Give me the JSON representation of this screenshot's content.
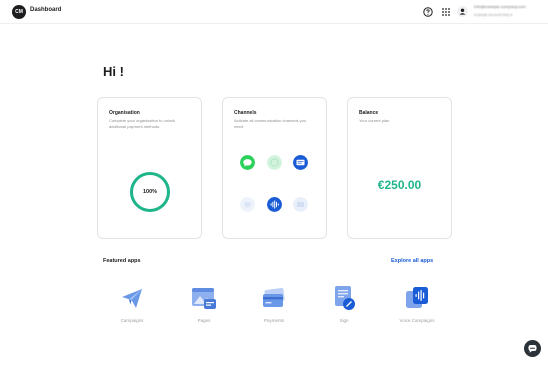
{
  "header": {
    "logo_text": "CM",
    "app_title": "Dashboard",
    "account_name": "info@example-company.com",
    "account_sub": "Example Account  Help &"
  },
  "greeting": "Hi !",
  "cards": {
    "organisation": {
      "title": "Organisation",
      "description": "Complete your organisation to unlock additional payment methods.",
      "progress_label": "100%",
      "progress": 1.0
    },
    "channels": {
      "title": "Channels",
      "description": "Activate all communication channels you need.",
      "items": [
        "sms",
        "whatsapp",
        "rcs",
        "apple-messages",
        "voice",
        "email"
      ]
    },
    "balance": {
      "title": "Balance",
      "description": "Your current plan",
      "amount": "€250.00"
    }
  },
  "featured": {
    "title": "Featured apps",
    "explore_label": "Explore all apps",
    "apps": [
      {
        "label": "Campaigns",
        "icon": "paper-plane-icon"
      },
      {
        "label": "Pages",
        "icon": "pages-icon"
      },
      {
        "label": "Payments",
        "icon": "credit-card-icon"
      },
      {
        "label": "Sign",
        "icon": "sign-document-icon"
      },
      {
        "label": "Voice Campaigns",
        "icon": "voice-icon"
      }
    ]
  },
  "colors": {
    "accent_green": "#1fb58a",
    "link_blue": "#1a5bd6"
  }
}
